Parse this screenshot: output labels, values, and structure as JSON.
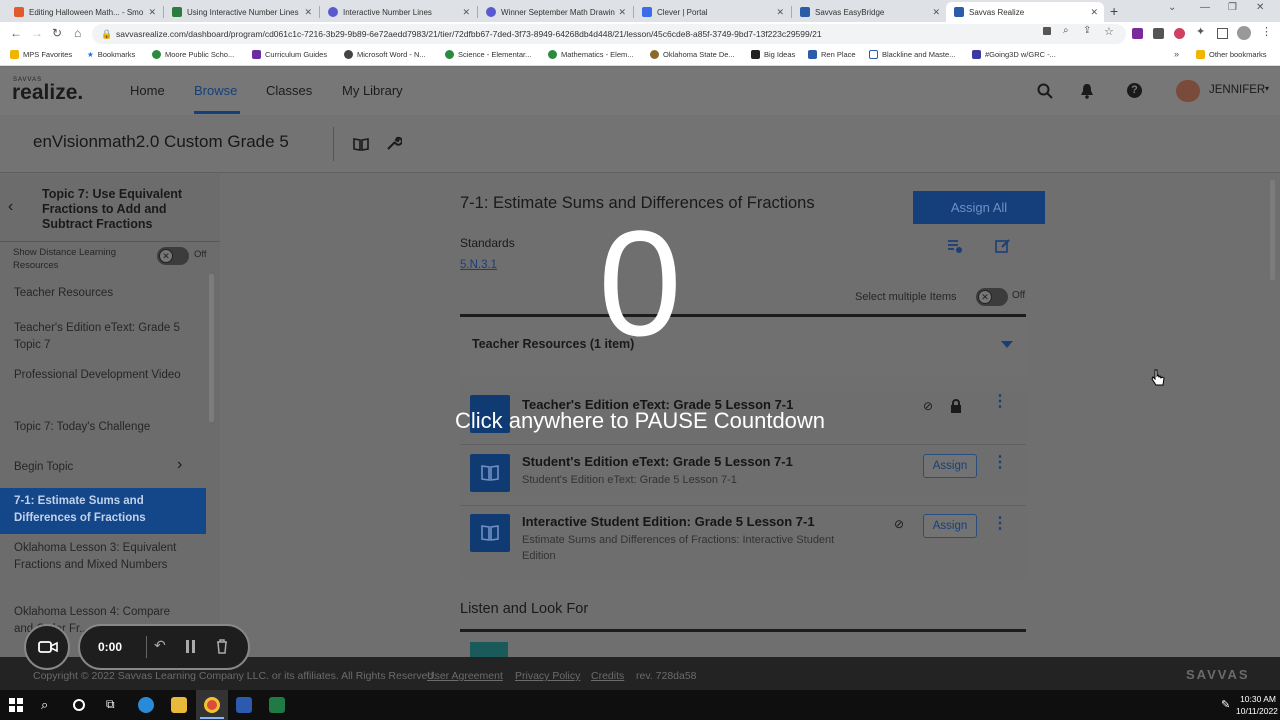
{
  "browser": {
    "tabs": [
      {
        "title": "Editing Halloween Math... - Smo",
        "color": "#e05a2b"
      },
      {
        "title": "Using Interactive Number Lines",
        "color": "#2b7d3d"
      },
      {
        "title": "Interactive Number Lines",
        "color": "#5a5ad0"
      },
      {
        "title": "Winner September Math Drawin",
        "color": "#5a5ad0"
      },
      {
        "title": "Clever | Portal",
        "color": "#3a6ee8"
      },
      {
        "title": "Savvas EasyBridge",
        "color": "#2a5caa"
      },
      {
        "title": "Savvas Realize",
        "color": "#2a5caa"
      }
    ],
    "url": "savvasrealize.com/dashboard/program/cd061c1c-7216-3b29-9b89-6e72aedd7983/21/tier/72dfbb67-7ded-3f73-8949-64268db4d448/21/lesson/45c6cde8-a85f-3749-9bd7-13f223c29599/21",
    "bookmarks": [
      "MPS Favorites",
      "Bookmarks",
      "Moore Public Scho...",
      "Curriculum Guides",
      "Microsoft Word - N...",
      "Science - Elementar...",
      "Mathematics - Elem...",
      "Oklahoma State De...",
      "Big Ideas",
      "Ren Place",
      "Blackline and Maste...",
      "#Going3D w/GRC -..."
    ],
    "other_bookmarks": "Other bookmarks"
  },
  "app": {
    "logo_top": "SAVVAS",
    "logo": "realize.",
    "nav": [
      "Home",
      "Browse",
      "Classes",
      "My Library"
    ],
    "user": "JENNIFER",
    "course_title": "enVisionmath2.0 Custom Grade 5"
  },
  "sidebar": {
    "topic_title": "Topic 7: Use Equivalent Fractions to Add and Subtract Fractions",
    "distance_label": "Show Distance Learning Resources",
    "distance_toggle": "Off",
    "items": [
      "Teacher Resources",
      "Teacher's Edition eText: Grade 5 Topic 7",
      "Professional Development Video",
      "Topic 7: Today's Challenge",
      "Begin Topic",
      "7-1: Estimate Sums and Differences of Fractions",
      "Oklahoma Lesson 3: Equivalent Fractions and Mixed Numbers",
      "Oklahoma Lesson 4: Compare and Order Fr..."
    ]
  },
  "lesson": {
    "title": "7-1: Estimate Sums and Differences of Fractions",
    "assign_all": "Assign All",
    "standards_label": "Standards",
    "standard_code": "5.N.3.1",
    "select_multiple": "Select multiple Items",
    "select_toggle": "Off",
    "section_title": "Teacher Resources (1 item)",
    "resources": [
      {
        "title": "Teacher's Edition eText: Grade 5 Lesson 7-1",
        "sub": "",
        "assign": ""
      },
      {
        "title": "Student's Edition eText: Grade 5 Lesson 7-1",
        "sub": "Student's Edition eText: Grade 5 Lesson 7-1",
        "assign": "Assign"
      },
      {
        "title": "Interactive Student Edition: Grade 5 Lesson 7-1",
        "sub": "Estimate Sums and Differences of Fractions: Interactive Student Edition",
        "assign": "Assign"
      }
    ],
    "listen_title": "Listen and Look For"
  },
  "footer": {
    "copyright": "Copyright © 2022 Savvas Learning Company LLC. or its affiliates. All Rights Reserved.",
    "links": [
      "User Agreement",
      "Privacy Policy",
      "Credits"
    ],
    "rev": "rev. 728da58",
    "brand": "SAVVAS"
  },
  "overlay": {
    "countdown": "0",
    "message": "Click anywhere to PAUSE Countdown",
    "timer": "0:00"
  },
  "taskbar": {
    "time": "10:30 AM",
    "date": "10/11/2022"
  }
}
